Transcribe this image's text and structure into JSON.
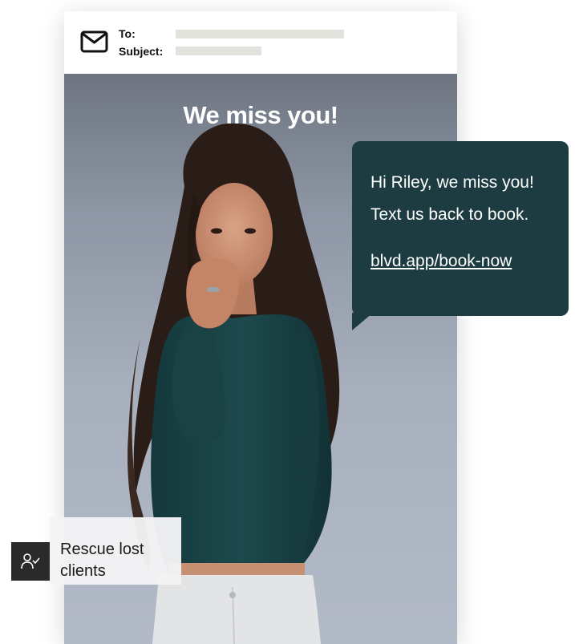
{
  "email": {
    "to_label": "To:",
    "subject_label": "Subject:",
    "hero_title": "We miss you!"
  },
  "sms": {
    "line1": "Hi Riley, we miss you!",
    "line2": "Text us back to book.",
    "link": "blvd.app/book-now"
  },
  "badge": {
    "icon": "user-check-icon",
    "label": "Rescue lost clients"
  },
  "icons": {
    "mail": "mail-icon"
  },
  "colors": {
    "sms_bubble": "#1c3c41",
    "badge_icon_bg": "#2a2a2a",
    "placeholder_bar": "#e3e3de",
    "shirt": "#183f42"
  }
}
